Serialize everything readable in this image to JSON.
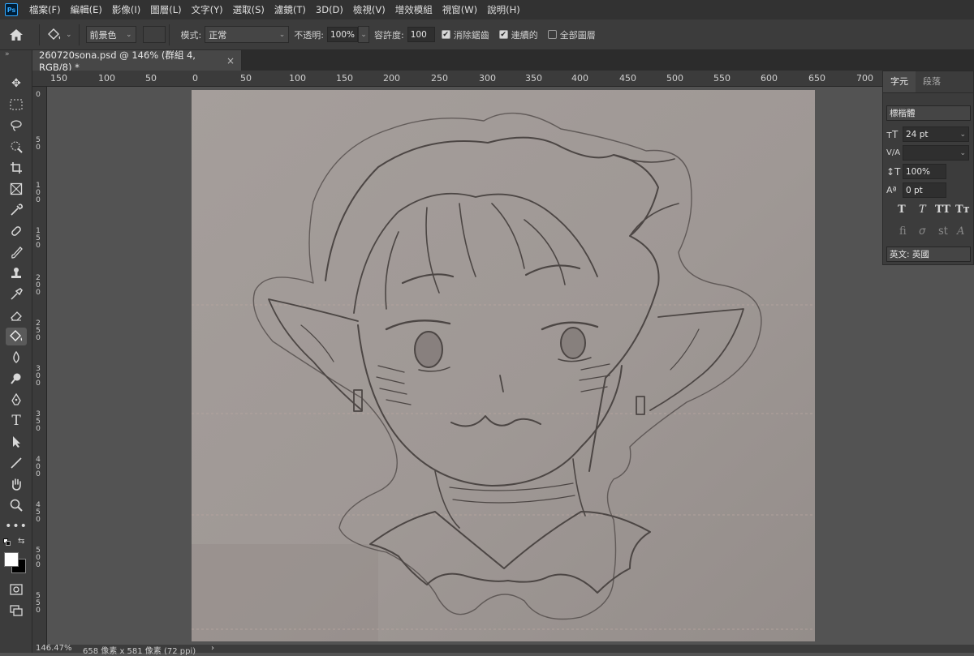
{
  "app": {
    "logo": "Ps"
  },
  "menu": [
    "檔案(F)",
    "編輯(E)",
    "影像(I)",
    "圖層(L)",
    "文字(Y)",
    "選取(S)",
    "濾鏡(T)",
    "3D(D)",
    "檢視(V)",
    "增效模組",
    "視窗(W)",
    "說明(H)"
  ],
  "options": {
    "fill_source": "前景色",
    "mode_label": "模式:",
    "mode_value": "正常",
    "opacity_label": "不透明:",
    "opacity_value": "100%",
    "tolerance_label": "容許度:",
    "tolerance_value": "100",
    "antialias_label": "消除鋸齒",
    "antialias_checked": true,
    "contiguous_label": "連續的",
    "contiguous_checked": true,
    "all_layers_label": "全部圖層",
    "all_layers_checked": false
  },
  "document": {
    "tab_title": "260720sona.psd @ 146% (群組 4, RGB/8) *"
  },
  "ruler": {
    "h_labels": [
      "150",
      "100",
      "50",
      "0",
      "50",
      "100",
      "150",
      "200",
      "250",
      "300",
      "350",
      "400",
      "450",
      "500",
      "550",
      "600",
      "650",
      "700"
    ],
    "v_labels": [
      "0",
      "50",
      "100",
      "150",
      "200",
      "250",
      "300",
      "350",
      "400",
      "450",
      "500",
      "550"
    ]
  },
  "character_panel": {
    "tabs": [
      "字元",
      "段落"
    ],
    "font_family": "標楷體",
    "font_size": "24 pt",
    "tracking": "",
    "vertical_scale": "100%",
    "baseline_shift": "0 pt",
    "language": "英文: 英國"
  },
  "status": {
    "zoom": "146.47%",
    "doc_size": "658 像素 x 581 像素 (72 ppi)"
  },
  "colors": {
    "foreground": "#ffffff",
    "background": "#000000",
    "accent": "#31a8ff"
  }
}
